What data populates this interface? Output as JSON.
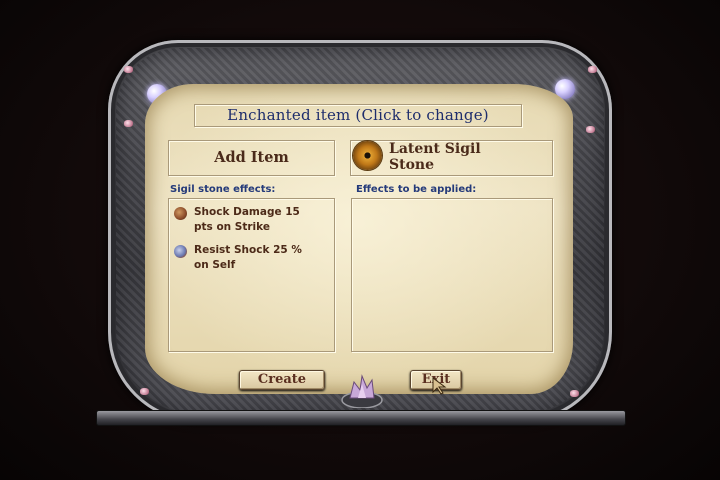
{
  "title_button": {
    "label": "Enchanted item (Click to change)"
  },
  "add_item": {
    "label": "Add Item"
  },
  "soul_gem": {
    "label_line1": "Latent Sigil",
    "label_line2": "Stone",
    "icon": "sigil-stone-icon"
  },
  "left_panel": {
    "heading": "Sigil stone effects:",
    "effects": [
      {
        "line1": "Shock Damage 15",
        "line2": "pts on Strike",
        "icon": "shock-damage-icon"
      },
      {
        "line1": "Resist Shock 25 %",
        "line2": "on Self",
        "icon": "resist-shock-icon"
      }
    ]
  },
  "right_panel": {
    "heading": "Effects to be applied:"
  },
  "buttons": {
    "create": "Create",
    "exit": "Exit"
  },
  "colors": {
    "parchment": "#eee3c3",
    "heading_blue": "#243a7a",
    "text_brown": "#4c2a18",
    "title_blue": "#1e2d6c"
  }
}
